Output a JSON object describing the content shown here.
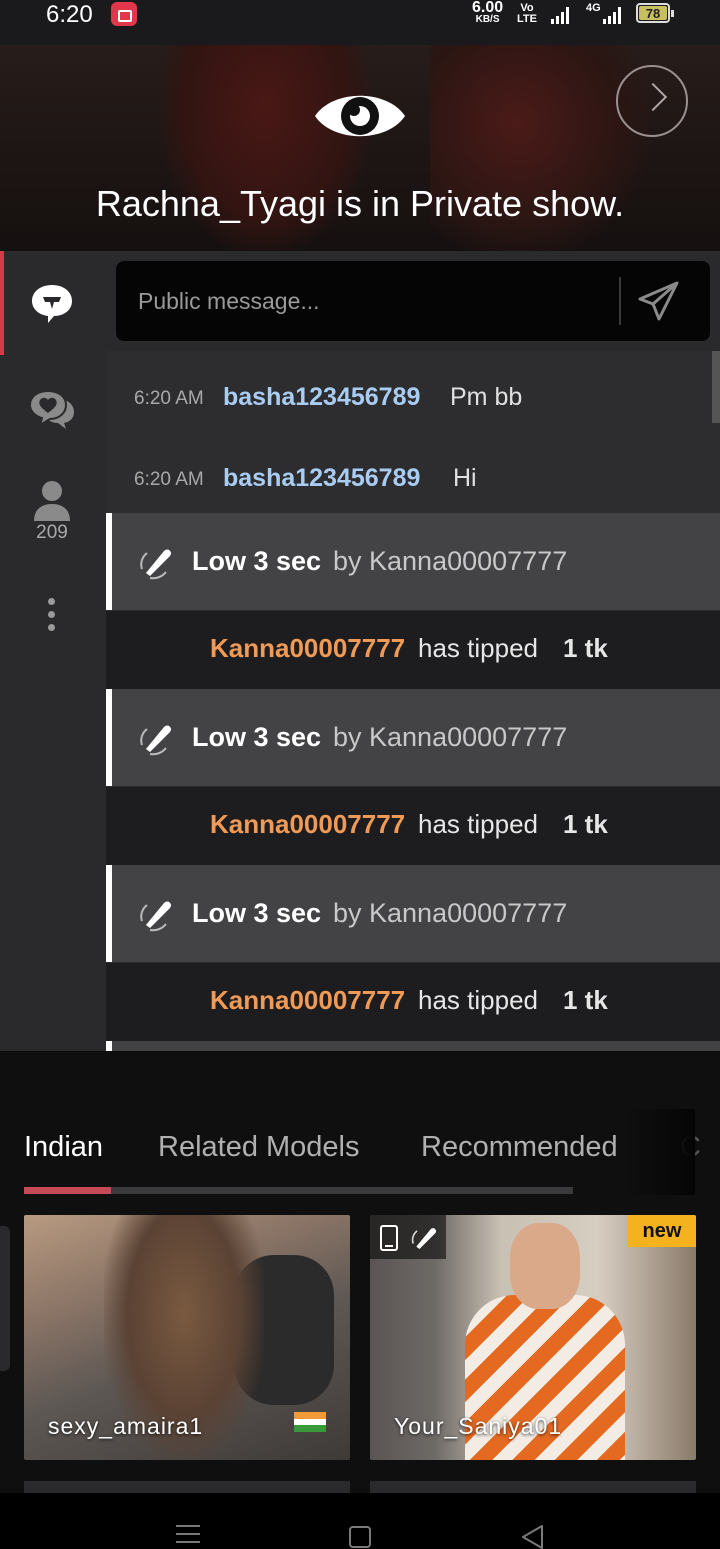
{
  "status_bar": {
    "time": "6:20",
    "net_speed": "6.00",
    "net_speed_unit": "KB/S",
    "volte": "Vo LTE",
    "network": "4G",
    "battery": "78"
  },
  "banner": {
    "message": "Rachna_Tyagi is in Private show."
  },
  "rail": {
    "users_count": "209"
  },
  "chat": {
    "input_placeholder": "Public message...",
    "messages": [
      {
        "time": "6:20 AM",
        "user": "basha123456789",
        "text": "Pm bb"
      },
      {
        "time": "6:20 AM",
        "user": "basha123456789",
        "text": "Hi"
      }
    ],
    "events": [
      {
        "level": "Low 3 sec",
        "by": "by Kanna00007777",
        "tipper": "Kanna00007777",
        "tip_text": "has tipped",
        "amount": "1 tk"
      },
      {
        "level": "Low 3 sec",
        "by": "by Kanna00007777",
        "tipper": "Kanna00007777",
        "tip_text": "has tipped",
        "amount": "1 tk"
      },
      {
        "level": "Low 3 sec",
        "by": "by Kanna00007777",
        "tipper": "Kanna00007777",
        "tip_text": "has tipped",
        "amount": "1 tk"
      }
    ]
  },
  "tabs": [
    {
      "label": "Indian",
      "active": true
    },
    {
      "label": "Related Models",
      "active": false
    },
    {
      "label": "Recommended",
      "active": false
    },
    {
      "label": "C",
      "active": false
    }
  ],
  "models": [
    {
      "name": "sexy_amaira1",
      "flag": "India"
    },
    {
      "name": "Your_Saniya01",
      "badge": "new"
    }
  ],
  "colors": {
    "accent": "#d23b47",
    "username": "#a9cdf2",
    "tipper": "#f09a55",
    "new_badge": "#f4b31e"
  }
}
